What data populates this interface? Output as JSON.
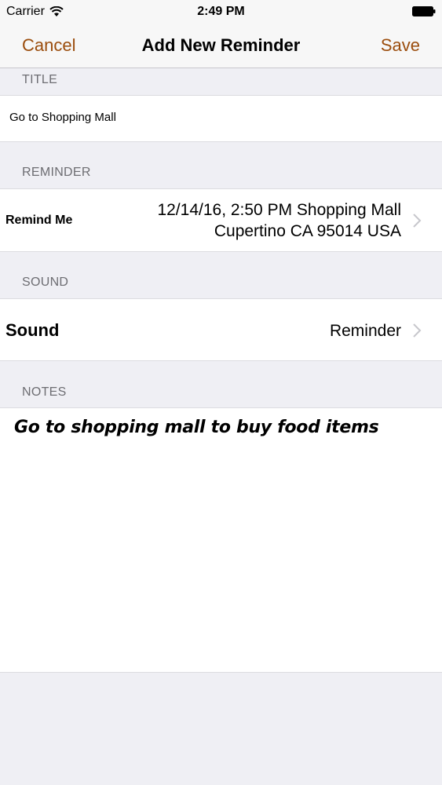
{
  "status_bar": {
    "carrier": "Carrier",
    "time": "2:49 PM"
  },
  "nav": {
    "cancel": "Cancel",
    "title": "Add New Reminder",
    "save": "Save"
  },
  "accent_color": "#9b4d0d",
  "sections": {
    "title_header": "TITLE",
    "reminder_header": "REMINDER",
    "sound_header": "SOUND",
    "notes_header": "NOTES"
  },
  "title_field": {
    "value": "Go to Shopping Mall"
  },
  "remind_me": {
    "label": "Remind Me",
    "value_line1": "12/14/16, 2:50 PM Shopping Mall",
    "value_line2": "Cupertino CA 95014 USA"
  },
  "sound": {
    "label": "Sound",
    "value": "Reminder"
  },
  "notes": {
    "text": "Go to shopping mall to buy food items"
  }
}
